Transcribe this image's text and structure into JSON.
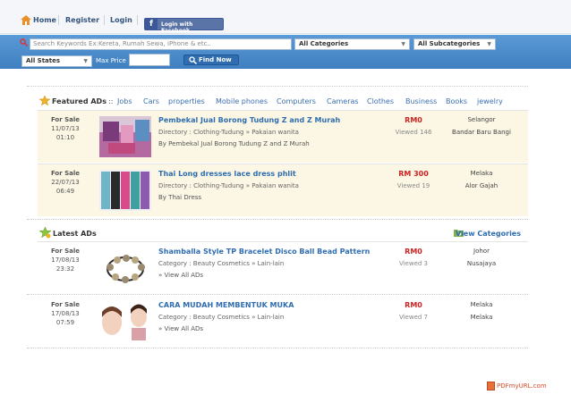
{
  "nav": {
    "home_label": "Home",
    "register_label": "Register",
    "login_label": "Login",
    "facebook_label": "Login with Facebook"
  },
  "search": {
    "placeholder": "Search Keywords Ex:Kereta, Rumah Sewa, iPhone & etc..",
    "category_value": "All Categories",
    "subcategory_value": "All Subcategories",
    "state_value": "All States",
    "max_price_label": "Max Price",
    "find_label": "Find Now"
  },
  "featured": {
    "title": "Featured ADs",
    "separator": "::",
    "categories": [
      "Jobs",
      "Cars",
      "properties",
      "Mobile phones",
      "Computers",
      "Cameras",
      "Clothes",
      "Business",
      "Books",
      "jewelry"
    ],
    "items": [
      {
        "status": "For Sale",
        "date": "11/07/13",
        "time": "01:10",
        "title": "Pembekal Jual Borong Tudung Z and Z Murah",
        "directory": "Directory : Clothing-Tudung » Pakaian wanita",
        "subtitle": "By Pembekal Jual Borong Tudung Z and Z Murah",
        "price": "RM0",
        "viewed": "Viewed 146",
        "state": "Selangor",
        "city": "Bandar Baru Bangi"
      },
      {
        "status": "For Sale",
        "date": "22/07/13",
        "time": "06:49",
        "title": "Thai Long dresses lace dress phlit",
        "directory": "Directory : Clothing-Tudung » Pakaian wanita",
        "subtitle": "By Thai Dress",
        "price": "RM 300",
        "viewed": "Viewed 19",
        "state": "Melaka",
        "city": "Alor Gajah"
      }
    ]
  },
  "latest": {
    "title": "Latest ADs",
    "view_categories_label": "View Categories",
    "items": [
      {
        "status": "For Sale",
        "date": "17/08/13",
        "time": "23:32",
        "title": "Shamballa Style TP Bracelet Disco Ball Bead Pattern",
        "directory": "Category : Beauty Cosmetics » Lain-lain",
        "subtitle": "» View All ADs",
        "price": "RM0",
        "viewed": "Viewed 3",
        "state": "Johor",
        "city": "Nusajaya"
      },
      {
        "status": "For Sale",
        "date": "17/08/13",
        "time": "07:59",
        "title": "CARA MUDAH MEMBENTUK MUKA",
        "directory": "Category : Beauty Cosmetics » Lain-lain",
        "subtitle": "» View All ADs",
        "price": "RM0",
        "viewed": "Viewed 7",
        "state": "Melaka",
        "city": "Melaka"
      }
    ]
  },
  "footer": {
    "pdf_label": "PDFmyURL.com"
  },
  "colors": {
    "link": "#2f6db0",
    "price": "#cc2222",
    "search_bar": "#4e8fcf",
    "featured_row_bg": "#fbf7e4"
  }
}
